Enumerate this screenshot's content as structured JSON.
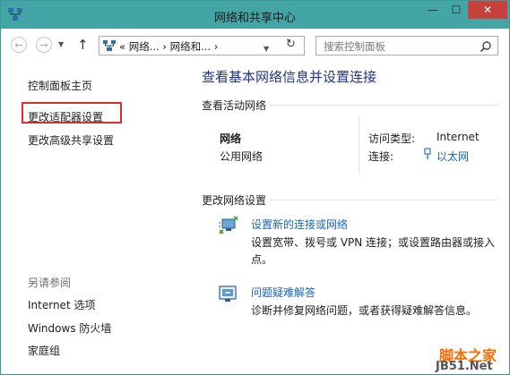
{
  "window": {
    "title": "网络和共享中心",
    "minimize": "—",
    "maximize": "☐",
    "close": "✕"
  },
  "nav": {
    "back": "←",
    "forward": "→",
    "up": "↑",
    "address_text": "«  网络...  ›  网络和...  ›",
    "refresh": "↻",
    "search_placeholder": "搜索控制面板"
  },
  "left": {
    "home": "控制面板主页",
    "change_adapter": "更改适配器设置",
    "change_sharing": "更改高级共享设置",
    "see_also": "另请参阅",
    "internet_options": "Internet 选项",
    "firewall": "Windows 防火墙",
    "homegroup": "家庭组"
  },
  "main": {
    "heading": "查看基本网络信息并设置连接",
    "active_networks": "查看活动网络",
    "network_name": "网络",
    "network_type": "公用网络",
    "access_type_label": "访问类型:",
    "access_type_value": "Internet",
    "connections_label": "连接:",
    "connection_value": "以太网",
    "change_settings": "更改网络设置",
    "setup_link": "设置新的连接或网络",
    "setup_desc": "设置宽带、拨号或 VPN 连接；或设置路由器或接入点。",
    "troubleshoot_link": "问题疑难解答",
    "troubleshoot_desc": "诊断并修复网络问题，或者获得疑难解答信息。"
  },
  "watermark": {
    "line1": "脚本之家",
    "line2": "JB51.Net"
  },
  "colors": {
    "titlebar": "#43a5a5",
    "close": "#c7413c",
    "link": "#1a64b8",
    "heading": "#1e3287",
    "highlight": "#d9302c"
  }
}
